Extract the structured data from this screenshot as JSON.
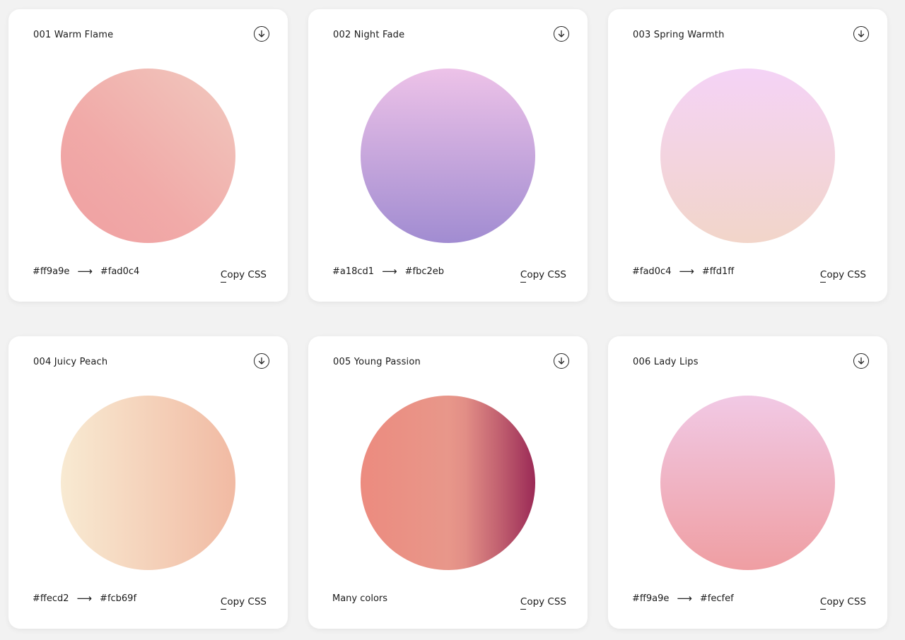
{
  "cards": [
    {
      "title": "001 Warm Flame",
      "from": "#ff9a9e",
      "to": "#fad0c4",
      "arrow": "⟶",
      "copy_label": "Copy CSS",
      "swatch_css": "linear-gradient(45deg, #ef9fa1 0%, #f1aaa8 40%, #f1c9bf 100%)"
    },
    {
      "title": "002 Night Fade",
      "from": "#a18cd1",
      "to": "#fbc2eb",
      "arrow": "⟶",
      "copy_label": "Copy CSS",
      "swatch_css": "linear-gradient(to top, #a18cd1 0%, #edc2e8 100%)"
    },
    {
      "title": "003 Spring Warmth",
      "from": "#fad0c4",
      "to": "#ffd1ff",
      "arrow": "⟶",
      "copy_label": "Copy CSS",
      "swatch_css": "linear-gradient(to top, #f2d5c9 0%, #f4d3f6 100%)"
    },
    {
      "title": "004 Juicy Peach",
      "from": "#ffecd2",
      "to": "#fcb69f",
      "arrow": "⟶",
      "copy_label": "Copy CSS",
      "swatch_css": "linear-gradient(to right, #f8ead2 0%, #f1baa3 100%)"
    },
    {
      "title": "005 Young Passion",
      "colors_text": "Many colors",
      "copy_label": "Copy CSS",
      "swatch_css": "linear-gradient(to right, #ec8b7f 0%, #e8978a 50%, #e28e86 60%, #c05f6f 80%, #9b2a56 100%)"
    },
    {
      "title": "006 Lady Lips",
      "from": "#ff9a9e",
      "to": "#fecfef",
      "arrow": "⟶",
      "copy_label": "Copy CSS",
      "swatch_css": "linear-gradient(to top, #ef9ea2 0%, #f1c9e5 100%)"
    }
  ],
  "icons": {
    "download": "download-circle-icon"
  }
}
